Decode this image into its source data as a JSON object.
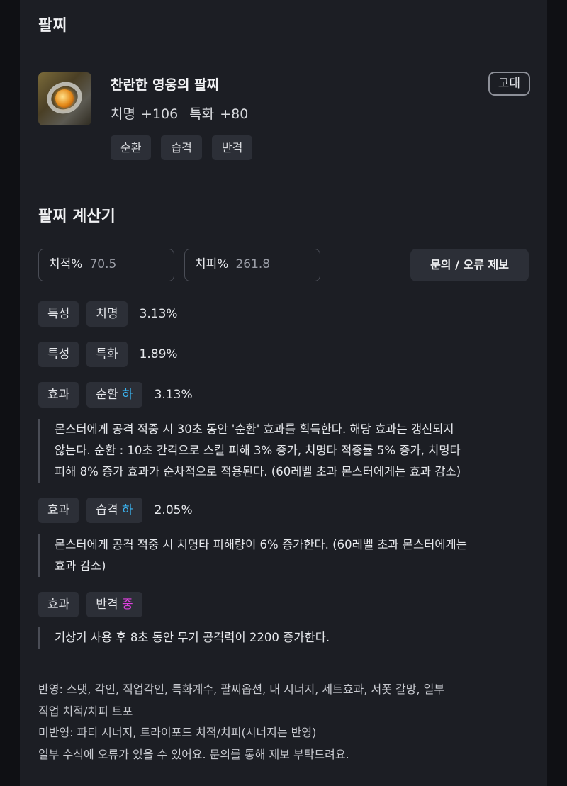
{
  "section_title": "팔찌",
  "bracelet": {
    "name": "찬란한 영웅의 팔찌",
    "stats": "치명 +106  특화 +80",
    "grade": "고대",
    "tags": [
      "순환",
      "습격",
      "반격"
    ],
    "icon": "bracelet-icon"
  },
  "calculator": {
    "title": "팔찌 계산기",
    "crit_rate_label": "치적%",
    "crit_rate_value": "70.5",
    "crit_dmg_label": "치피%",
    "crit_dmg_value": "261.8",
    "report_button": "문의 / 오류 제보"
  },
  "rows": [
    {
      "type": "특성",
      "name": "치명",
      "level": "",
      "pct": "3.13%"
    },
    {
      "type": "특성",
      "name": "특화",
      "level": "",
      "pct": "1.89%"
    },
    {
      "type": "효과",
      "name": "순환",
      "level": "하",
      "pct": "3.13%",
      "desc": "몬스터에게 공격 적중 시 30초 동안 '순환' 효과를 획득한다. 해당 효과는 갱신되지 않는다. 순환 : 10초 간격으로 스킬 피해 3% 증가, 치명타 적중률 5% 증가, 치명타 피해 8% 증가 효과가 순차적으로 적용된다. (60레벨 초과 몬스터에게는 효과 감소)"
    },
    {
      "type": "효과",
      "name": "습격",
      "level": "하",
      "pct": "2.05%",
      "desc": "몬스터에게 공격 적중 시 치명타 피해량이 6% 증가한다. (60레벨 초과 몬스터에게는 효과 감소)"
    },
    {
      "type": "효과",
      "name": "반격",
      "level": "중",
      "pct": "",
      "desc": "기상기 사용 후 8초 동안 무기 공격력이 2200 증가한다."
    }
  ],
  "desc_lines": {
    "d1": [
      "몬스터에게 공격 적중 시 30초 동안 '순환' 효과를 획득한다. 해당 효과는 갱신되지",
      "않는다. 순환 : 10초 간격으로 스킬 피해 3% 증가, 치명타 적중률 5% 증가, 치명타",
      "피해 8% 증가 효과가 순차적으로 적용된다. (60레벨 초과 몬스터에게는 효과 감소)"
    ],
    "d2": [
      "몬스터에게 공격 적중 시 치명타 피해량이 6% 증가한다. (60레벨 초과 몬스터에게는",
      "효과 감소)"
    ],
    "d3": [
      "기상기 사용 후 8초 동안 무기 공격력이 2200 증가한다."
    ]
  },
  "notes": [
    "반영: 스탯, 각인, 직업각인, 특화계수, 팔찌옵션, 내 시너지, 세트효과, 서폿 갈망, 일부",
    "직업 치적/치피 트포",
    "미반영: 파티 시너지, 트라이포드 치적/치피(시너지는 반영)",
    "일부 수식에 오류가 있을 수 있어요. 문의를 통해 제보 부탁드려요."
  ],
  "colors": {
    "level_low": "#3ab3f0",
    "level_mid": "#e040e0",
    "panel_bg": "#1c1e24",
    "page_bg": "#0f1014"
  }
}
